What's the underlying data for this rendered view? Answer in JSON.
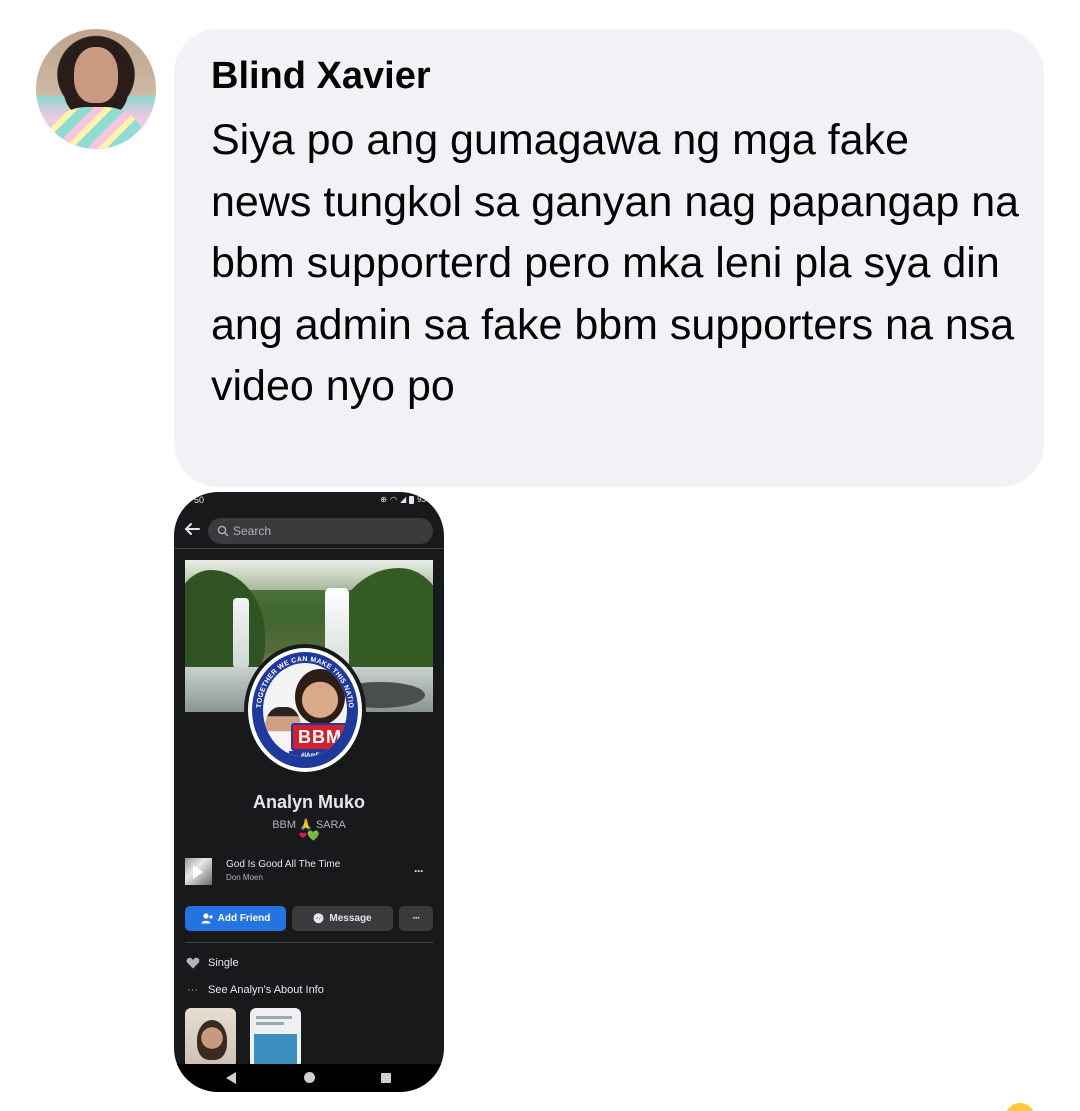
{
  "comment": {
    "author": "Blind Xavier",
    "text": "Siya po ang gumagawa ng mga fake news tungkol sa ganyan nag papangap na bbm supporterd pero mka leni pla sya din ang admin sa fake bbm supporters na nsa video nyo po"
  },
  "attachment": {
    "status_bar": {
      "time": "50",
      "battery": "93"
    },
    "search": {
      "placeholder": "Search"
    },
    "profile_picture": {
      "ring_text": "TOGETHER WE CAN MAKE THIS NATION GREAT AGAIN",
      "logo": "BBM",
      "hashtag": "#IAmForBBM"
    },
    "profile": {
      "name": "Analyn Muko",
      "bio": "BBM 🙏 SARA",
      "bio_hearts_red": "❤",
      "bio_hearts_green": "💚"
    },
    "music": {
      "title": "God Is Good All The Time",
      "artist": "Don Moen",
      "more": "···"
    },
    "buttons": {
      "add_friend": "Add Friend",
      "message": "Message",
      "more": "···"
    },
    "info": {
      "relationship": "Single",
      "about": "See Analyn's About Info",
      "about_icon": "···"
    }
  },
  "colors": {
    "bubble": "#f0f2f5",
    "fb_blue": "#2374e1",
    "dark_bg": "#18191a",
    "bbm_red": "#d42130",
    "bbm_blue": "#1f3a9c"
  }
}
